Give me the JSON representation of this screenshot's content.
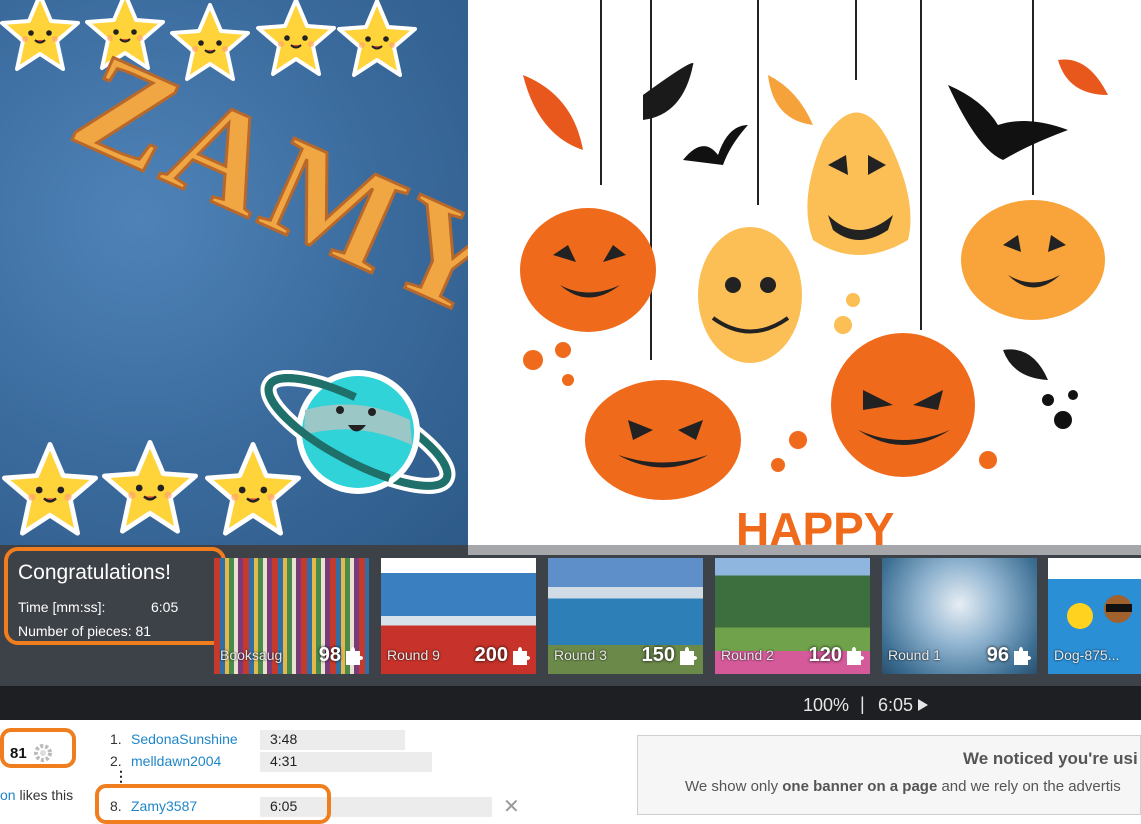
{
  "top_images": {
    "left_wordmark": "ZAMY",
    "right_caption": "HAPPY"
  },
  "congrats": {
    "title": "Congratulations!",
    "time_label": "Time [mm:ss]:",
    "time_value": "6:05",
    "pieces_label": "Number of pieces:",
    "pieces_value": "81"
  },
  "thumbnails": [
    {
      "label": "Booksaug",
      "count": "98",
      "icon": "puzzle-piece-icon"
    },
    {
      "label": "Round 9",
      "count": "200",
      "icon": "puzzle-piece-icon"
    },
    {
      "label": "Round 3",
      "count": "150",
      "icon": "puzzle-piece-icon"
    },
    {
      "label": "Round 2",
      "count": "120",
      "icon": "puzzle-piece-icon"
    },
    {
      "label": "Round 1",
      "count": "96",
      "icon": "puzzle-piece-icon"
    },
    {
      "label": "Dog-875...",
      "count": "",
      "icon": ""
    }
  ],
  "status_bar": {
    "zoom": "100%",
    "separator": "|",
    "timer": "6:05",
    "play_icon": "play-icon"
  },
  "pieces_badge": {
    "value": "81",
    "icon": "gear-piece-icon"
  },
  "likes_text": {
    "link": "on",
    "rest": " likes this"
  },
  "leaderboard": [
    {
      "rank": "1.",
      "name": "SedonaSunshine",
      "time": "3:48"
    },
    {
      "rank": "2.",
      "name": "melldawn2004",
      "time": "4:31"
    },
    {
      "rank": "8.",
      "name": "Zamy3587",
      "time": "6:05"
    }
  ],
  "ellipsis": "⋮",
  "close_label": "✕",
  "notice": {
    "title": "We noticed you're usi",
    "text_pre": "We show only ",
    "text_bold": "one banner on a page",
    "text_post": " and we rely on the advertis"
  },
  "colors": {
    "highlight_orange": "#f07d1e",
    "link_blue": "#1e86c8",
    "strip_bg": "#3d4148",
    "status_bg": "#1d1f22"
  }
}
